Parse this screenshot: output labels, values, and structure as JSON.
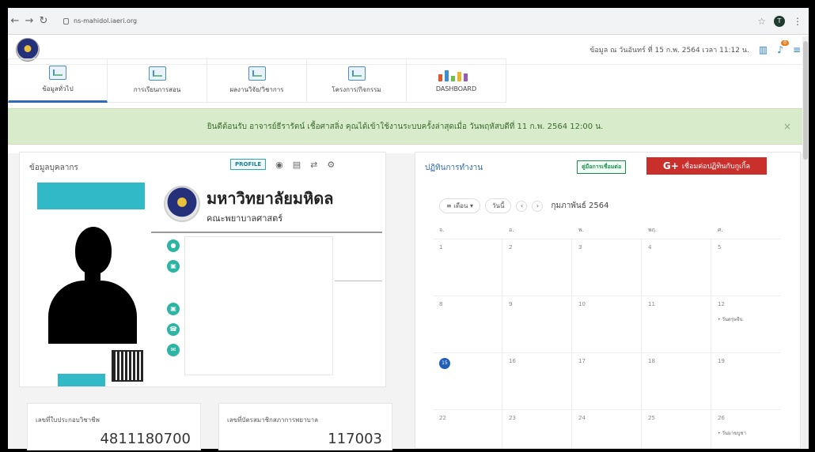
{
  "browser": {
    "url": "ns-mahidol.iaeri.org"
  },
  "header": {
    "user_text": "ข้อมูล ณ วันอันทร์ ที่ 15 ก.พ. 2564 เวลา 11:12 น.",
    "notif_count": "0"
  },
  "menu": [
    {
      "label": "ข้อมูลทั่วไป"
    },
    {
      "label": "การเรียนการสอน"
    },
    {
      "label": "ผลงานวิจัย/วิชาการ"
    },
    {
      "label": "โครงการ/กิจกรรม"
    },
    {
      "label": "DASHBOARD"
    }
  ],
  "alert": {
    "text": "ยินดีต้อนรับ อาจารย์ธีรารัตน์ เชื้อศาสลิ่ง คุณได้เข้าใช้งานระบบครั้งล่าสุดเมื่อ วันพฤหัสบดีที่ 11 ก.พ. 2564 12:00 น."
  },
  "personnel": {
    "title": "ข้อมูลบุคลากร",
    "profile_btn": "PROFILE",
    "university": "มหาวิทยาลัยมหิดล",
    "faculty": "คณะพยาบาลศาสตร์"
  },
  "cards": [
    {
      "label": "เลขที่ใบประกอบวิชาชีพ",
      "value": "4811180700"
    },
    {
      "label": "เลขที่บัตรสมาชิกสภาการพยาบาล",
      "value": "117003"
    }
  ],
  "calendar": {
    "title": "ปฏิทินการทำงาน",
    "guide_btn": "คู่มือการเชื่อมต่อ",
    "gplus_btn": "เชื่อมต่อปฏิทินกับกูเกิ้ล",
    "view_select": "เดือน",
    "today_btn": "วันนี้",
    "prev": "‹",
    "next": "›",
    "month": "กุมภาพันธ์ 2564",
    "days": [
      "จ.",
      "อ.",
      "พ.",
      "พฤ.",
      "ศ."
    ],
    "weeks": [
      [
        {
          "d": "1"
        },
        {
          "d": "2"
        },
        {
          "d": "3"
        },
        {
          "d": "4"
        },
        {
          "d": "5"
        }
      ],
      [
        {
          "d": "8"
        },
        {
          "d": "9"
        },
        {
          "d": "10"
        },
        {
          "d": "11"
        },
        {
          "d": "12",
          "ev": "• วันตรุษจีน"
        }
      ],
      [
        {
          "d": "15",
          "today": true
        },
        {
          "d": "16"
        },
        {
          "d": "17"
        },
        {
          "d": "18"
        },
        {
          "d": "19"
        }
      ],
      [
        {
          "d": "22"
        },
        {
          "d": "23"
        },
        {
          "d": "24"
        },
        {
          "d": "25"
        },
        {
          "d": "26",
          "ev": "• วันมาฆบูชา"
        }
      ]
    ]
  }
}
